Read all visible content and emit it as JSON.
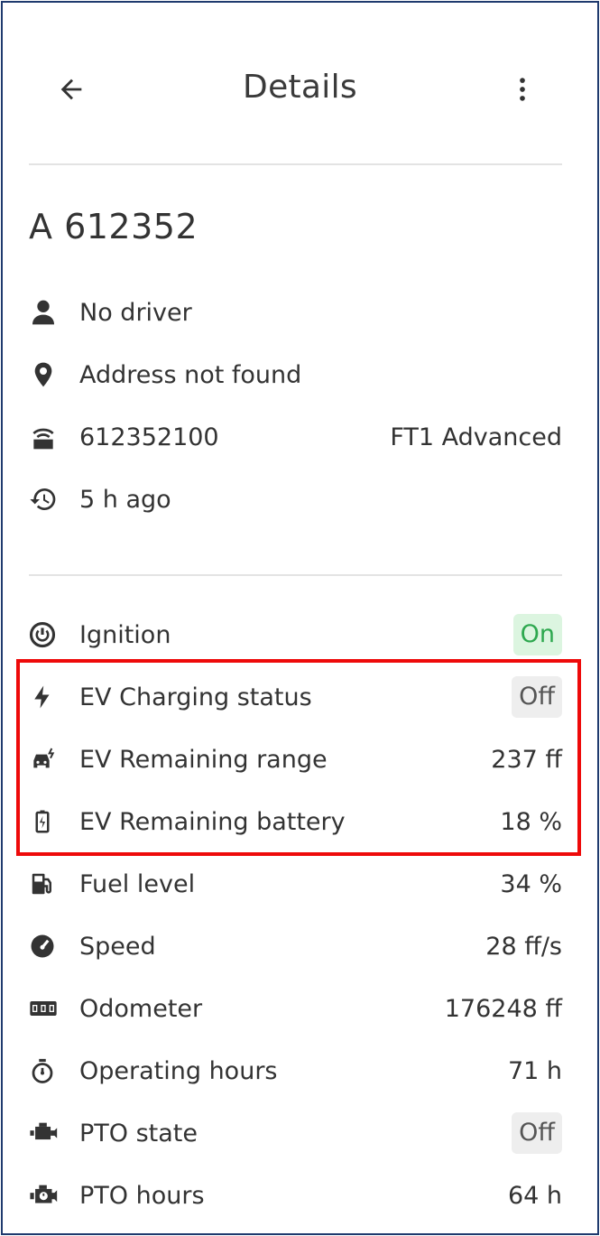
{
  "header": {
    "title": "Details"
  },
  "vehicle": {
    "id": "A 612352",
    "driver": "No driver",
    "address": "Address not found",
    "device_id": "612352100",
    "device_model": "FT1 Advanced",
    "last_seen": "5 h ago"
  },
  "status": [
    {
      "key": "ignition",
      "label": "Ignition",
      "value": "On",
      "icon": "power-icon",
      "badge": "on"
    },
    {
      "key": "ev-charging",
      "label": "EV Charging status",
      "value": "Off",
      "icon": "bolt-icon",
      "badge": "off"
    },
    {
      "key": "ev-range",
      "label": "EV Remaining range",
      "value": "237 ff",
      "icon": "ev-car-icon"
    },
    {
      "key": "ev-battery",
      "label": "EV Remaining battery",
      "value": "18 %",
      "icon": "battery-charging-icon"
    },
    {
      "key": "fuel",
      "label": "Fuel level",
      "value": "34 %",
      "icon": "fuel-pump-icon"
    },
    {
      "key": "speed",
      "label": "Speed",
      "value": "28 ff/s",
      "icon": "speedometer-icon"
    },
    {
      "key": "odometer",
      "label": "Odometer",
      "value": "176248 ff",
      "icon": "odometer-icon"
    },
    {
      "key": "operating-hours",
      "label": "Operating hours",
      "value": "71 h",
      "icon": "stopwatch-icon"
    },
    {
      "key": "pto-state",
      "label": "PTO state",
      "value": "Off",
      "icon": "engine-icon",
      "badge": "off"
    },
    {
      "key": "pto-hours",
      "label": "PTO hours",
      "value": "64 h",
      "icon": "engine-timer-icon"
    }
  ],
  "colors": {
    "highlight_border": "#ee0a0a",
    "badge_on_bg": "#dcf5e0",
    "badge_on_text": "#2ea84f",
    "badge_off_bg": "#eeeeee",
    "frame_border": "#1f3a6e"
  }
}
